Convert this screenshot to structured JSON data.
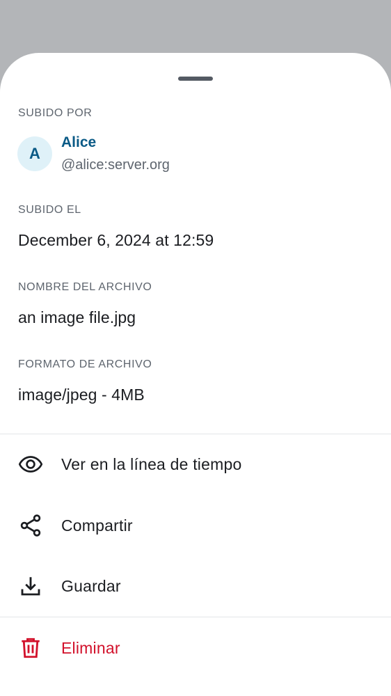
{
  "sheet": {
    "uploaded_by": {
      "label": "SUBIDO POR",
      "avatar_initial": "A",
      "name": "Alice",
      "user_id": "@alice:server.org"
    },
    "uploaded_on": {
      "label": "SUBIDO EL",
      "value": "December 6, 2024 at 12:59"
    },
    "file_name": {
      "label": "NOMBRE DEL ARCHIVO",
      "value": "an image file.jpg"
    },
    "file_format": {
      "label": "FORMATO DE ARCHIVO",
      "value": "image/jpeg - 4MB"
    }
  },
  "actions": {
    "view_in_timeline": {
      "label": "Ver en la línea de tiempo",
      "icon": "eye-icon"
    },
    "share": {
      "label": "Compartir",
      "icon": "share-icon"
    },
    "save": {
      "label": "Guardar",
      "icon": "download-icon"
    },
    "delete": {
      "label": "Eliminar",
      "icon": "trash-icon"
    }
  },
  "colors": {
    "scrim": "#b3b5b8",
    "accent": "#0a5a86",
    "avatar_bg": "#dff1f8",
    "danger": "#d2112b",
    "text_primary": "#1b1d21",
    "text_secondary": "#5e656e"
  }
}
